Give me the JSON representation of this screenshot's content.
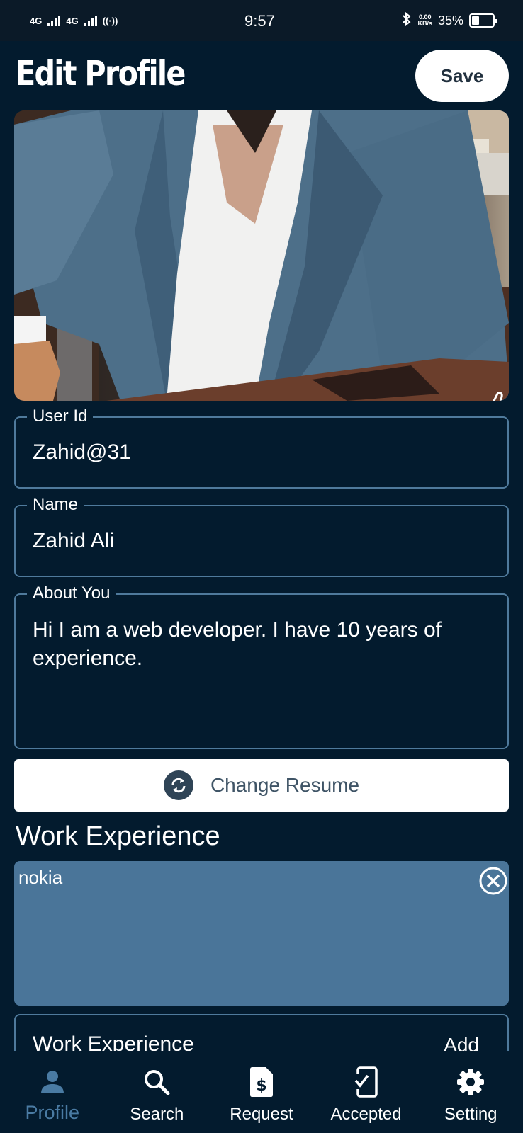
{
  "status_bar": {
    "network_1": "4G",
    "network_2": "4G",
    "time": "9:57",
    "speed_value": "0.00",
    "speed_unit": "KB/s",
    "battery": "35%",
    "battery_level": 0.35
  },
  "header": {
    "title": "Edit Profile",
    "save_label": "Save"
  },
  "photo": {
    "icon": "thumbs-up-icon"
  },
  "fields": {
    "user_id": {
      "label": "User Id",
      "value": "Zahid@31"
    },
    "name": {
      "label": "Name",
      "value": "Zahid Ali"
    },
    "about": {
      "label": "About You",
      "value": "Hi I am a web developer. I have 10 years of experience."
    }
  },
  "resume": {
    "label": "Change Resume",
    "icon": "sync-icon"
  },
  "work_experience": {
    "title": "Work Experience",
    "items": [
      {
        "name": "nokia"
      }
    ],
    "input_label": "Work Experience",
    "add_label": "Add"
  },
  "bottom_nav": {
    "items": [
      {
        "label": "Profile",
        "icon": "person-icon",
        "active": true
      },
      {
        "label": "Search",
        "icon": "search-icon",
        "active": false
      },
      {
        "label": "Request",
        "icon": "dollar-document-icon",
        "active": false
      },
      {
        "label": "Accepted",
        "icon": "phone-check-icon",
        "active": false
      },
      {
        "label": "Setting",
        "icon": "gear-icon",
        "active": false
      }
    ]
  },
  "colors": {
    "background": "#031b2e",
    "accent": "#4a7ba3",
    "card": "#4a7599"
  }
}
